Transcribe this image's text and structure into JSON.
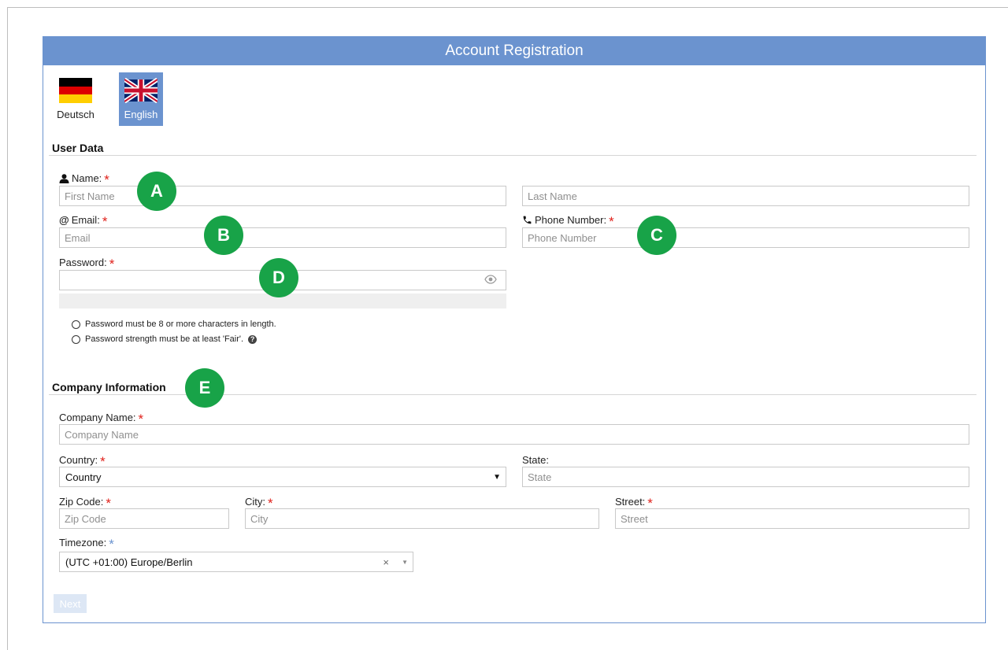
{
  "header": {
    "title": "Account Registration"
  },
  "languages": [
    {
      "label": "Deutsch",
      "active": false
    },
    {
      "label": "English",
      "active": true
    }
  ],
  "user_data": {
    "title": "User Data",
    "name_label": "Name:",
    "first_name_placeholder": "First Name",
    "last_name_placeholder": "Last Name",
    "email_label": "Email:",
    "email_placeholder": "Email",
    "phone_label": "Phone Number:",
    "phone_placeholder": "Phone Number",
    "password_label": "Password:",
    "password_rules": [
      "Password must be 8 or more characters in length.",
      "Password strength must be at least 'Fair'."
    ]
  },
  "company": {
    "title": "Company Information",
    "company_name_label": "Company Name:",
    "company_name_placeholder": "Company Name",
    "country_label": "Country:",
    "country_value": "Country",
    "state_label": "State:",
    "state_placeholder": "State",
    "zip_label": "Zip Code:",
    "zip_placeholder": "Zip Code",
    "city_label": "City:",
    "city_placeholder": "City",
    "street_label": "Street:",
    "street_placeholder": "Street",
    "timezone_label": "Timezone:",
    "timezone_value": "(UTC +01:00) Europe/Berlin"
  },
  "required_mark": "*",
  "next_label": "Next",
  "markers": [
    "A",
    "B",
    "C",
    "D",
    "E"
  ],
  "icons": {
    "name": "user-icon",
    "email": "at-icon",
    "phone": "phone-icon",
    "password_toggle": "eye-icon",
    "help": "question-icon",
    "clear": "clear-x-icon",
    "dropdown": "chevron-down-icon"
  },
  "colors": {
    "accent": "#6b93cf",
    "required": "#e0211b",
    "marker": "#18a348"
  }
}
